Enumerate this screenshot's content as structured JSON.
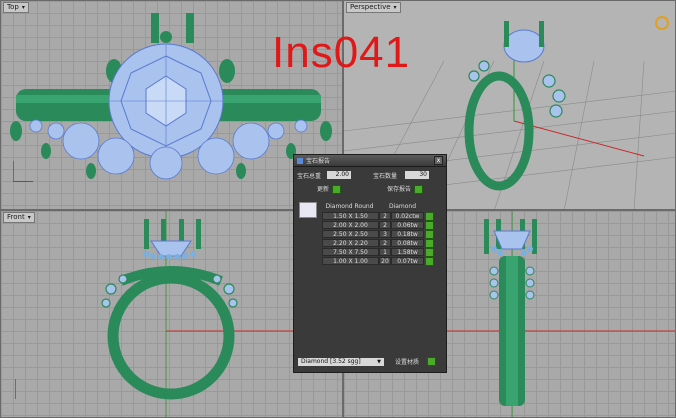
{
  "viewports": {
    "top": {
      "label": "Top"
    },
    "perspective": {
      "label": "Perspective"
    },
    "front": {
      "label": "Front"
    },
    "right": {
      "label": ""
    }
  },
  "watermark": "Ins041",
  "dialog": {
    "title": "宝石报告",
    "close": "x",
    "total_weight_label": "宝石总重",
    "total_weight_value": "2.00",
    "count_label": "宝石数量",
    "count_value": "30",
    "refresh_label": "更新",
    "save_label": "保存报告",
    "header_type": "Diamond Round",
    "header_material": "Diamond",
    "rows": [
      {
        "size": "1.50 X 1.50",
        "qty": "2",
        "weight": "0.02ctw"
      },
      {
        "size": "2.00 X 2.00",
        "qty": "2",
        "weight": "0.06tw"
      },
      {
        "size": "2.50 X 2.50",
        "qty": "3",
        "weight": "0.18tw"
      },
      {
        "size": "2.20 X 2.20",
        "qty": "2",
        "weight": "0.08tw"
      },
      {
        "size": "7.50 X 7.50",
        "qty": "1",
        "weight": "1.58tw"
      },
      {
        "size": "1.00 X 1.00",
        "qty": "20",
        "weight": "0.07tw"
      }
    ],
    "material_select": "Diamond  [3.52 sgg]",
    "set_material_label": "设置材质"
  },
  "colors": {
    "ring_metal": "#2a8a5a",
    "gem": "#9ab8e8",
    "grid_axis_x": "#c82a2a",
    "grid_axis_y": "#2a9a2a"
  }
}
